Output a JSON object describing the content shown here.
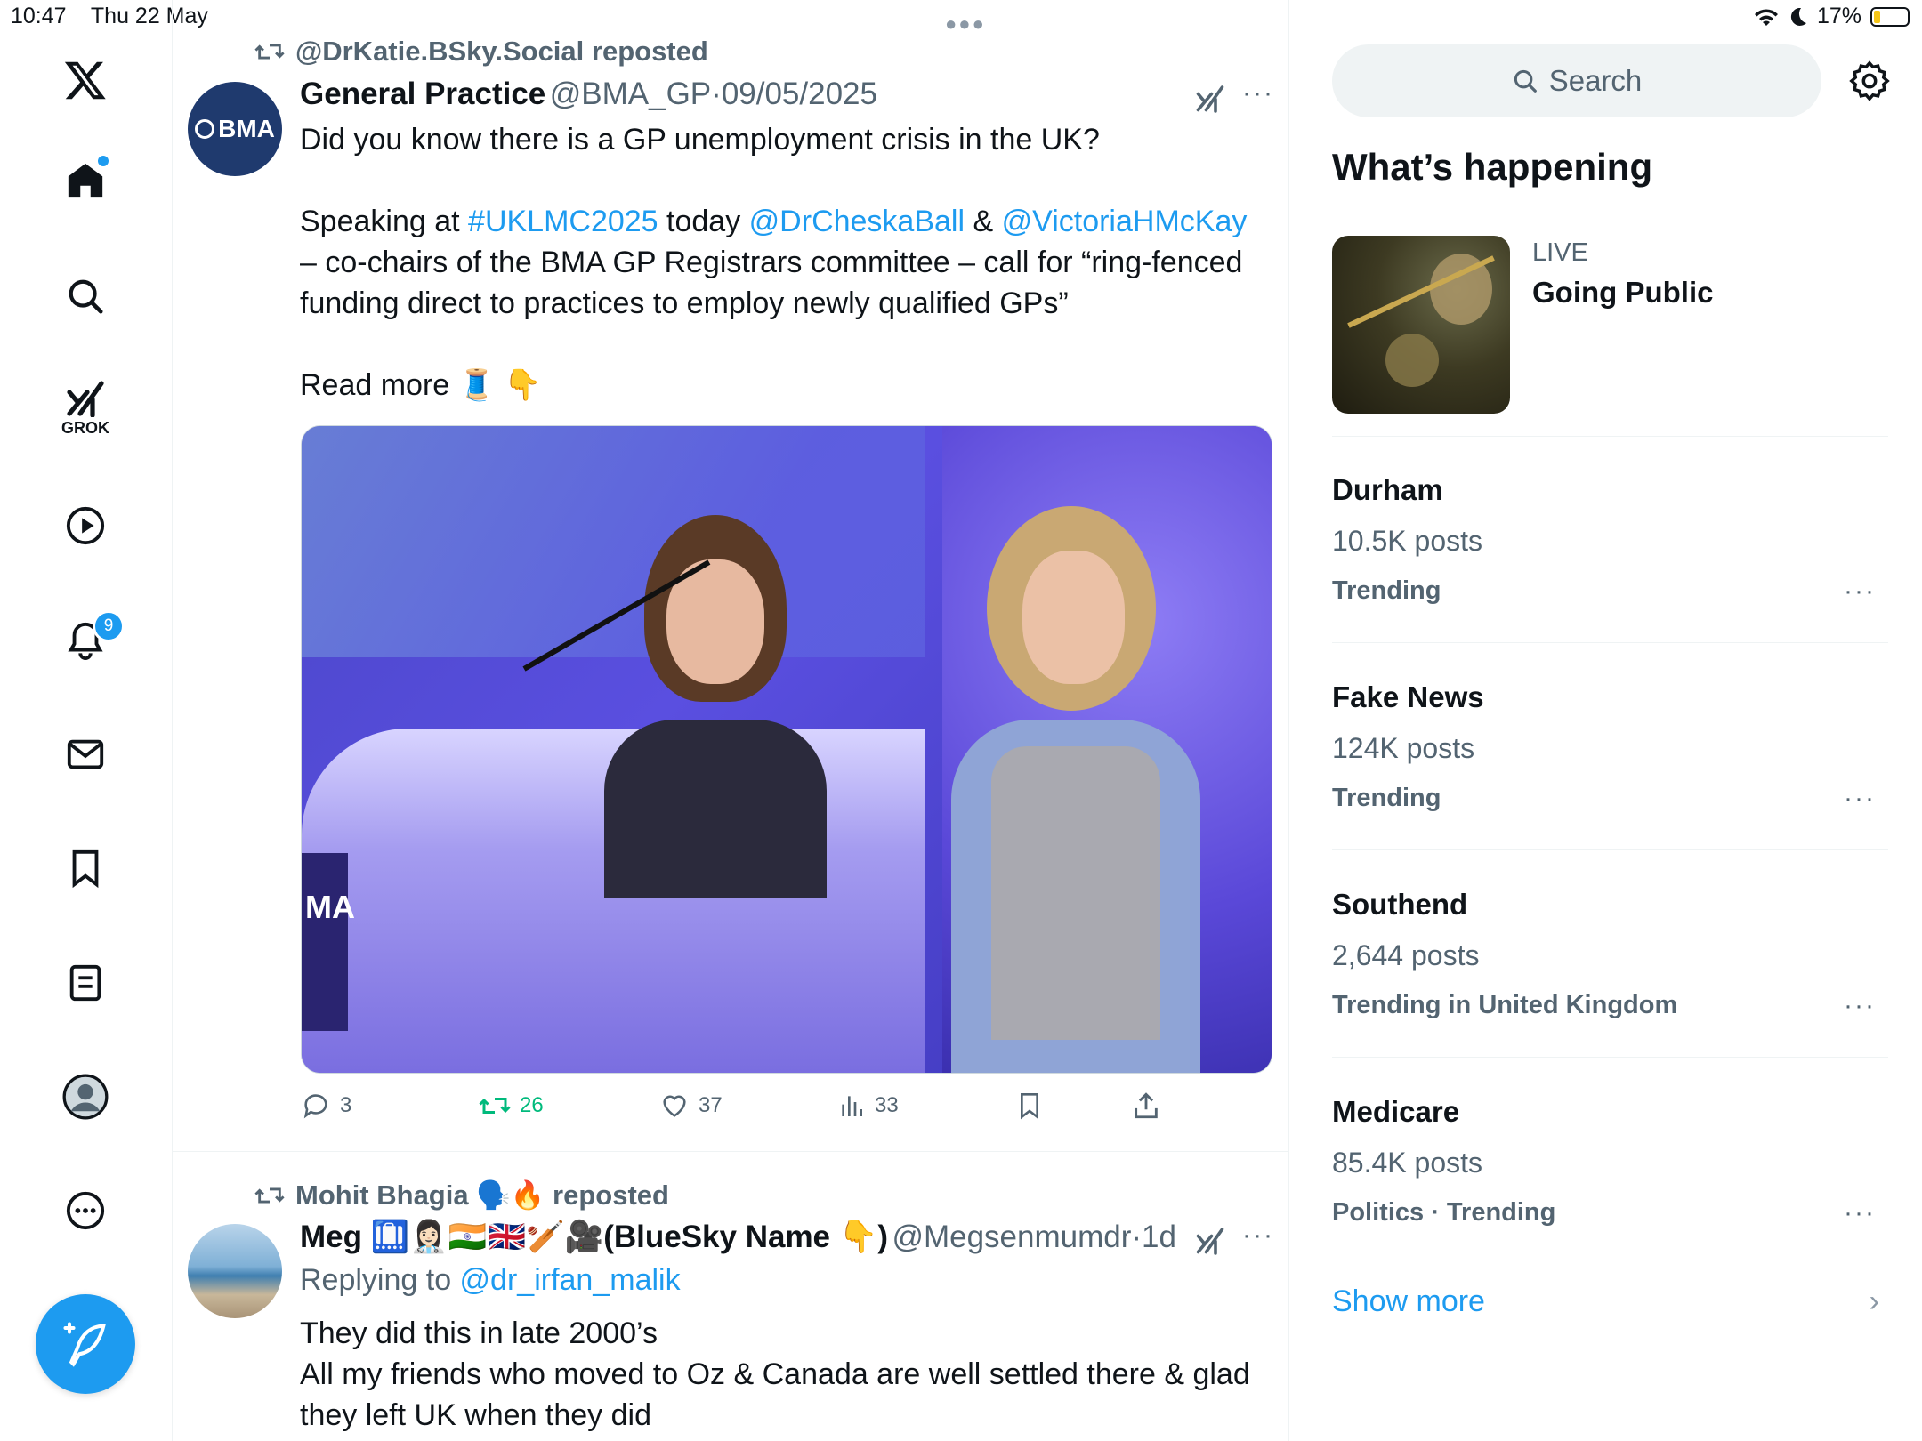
{
  "status_bar": {
    "time": "10:47",
    "date": "Thu 22 May",
    "battery": "17%"
  },
  "nav": {
    "grok_label": "GROK",
    "notifications_badge": "9"
  },
  "tweets": [
    {
      "repost_label": "@DrKatie.BSky.Social reposted",
      "avatar_text": "BMA",
      "name": "General Practice",
      "handle": "@BMA_GP",
      "sep": "·",
      "date": "09/05/2025",
      "line1": "Did you know there is a GP unemployment crisis in the UK?",
      "p2_a": "Speaking at ",
      "p2_tag": "#UKLMC2025",
      "p2_b": " today ",
      "p2_m1": "@DrCheskaBall",
      "p2_c": " & ",
      "p2_m2": "@VictoriaHMcKay",
      "p2_d": " – co-chairs of the BMA GP Registrars committee – call for “ring-fenced funding direct to practices to employ newly qualified GPs”",
      "read_more": "Read more 🧵 👇",
      "image_lanyard": "MA",
      "replies": "3",
      "reposts": "26",
      "likes": "37",
      "views": "33"
    },
    {
      "repost_label": "Mohit Bhagia 🗣️🔥 reposted",
      "name": "Meg 🛄👩🏻‍⚕️🇮🇳🇬🇧🏏🎥(BlueSky Name 👇)",
      "handle": "@Megsenmumdr",
      "sep": "·",
      "date": "1d",
      "replying_prefix": "Replying to ",
      "replying_to": "@dr_irfan_malik",
      "line1": "They did this in late 2000’s",
      "line2": "All my friends who moved to Oz & Canada are well settled there & glad they left UK when they did"
    }
  ],
  "sidebar": {
    "search_placeholder": "Search",
    "heading": "What’s happening",
    "live": {
      "tag": "LIVE",
      "title": "Going Public"
    },
    "trends": [
      {
        "title": "Durham",
        "posts": "10.5K posts",
        "context": "Trending"
      },
      {
        "title": "Fake News",
        "posts": "124K posts",
        "context": "Trending"
      },
      {
        "title": "Southend",
        "posts": "2,644 posts",
        "context": "Trending in United Kingdom"
      },
      {
        "title": "Medicare",
        "posts": "85.4K posts",
        "context": "Politics · Trending"
      }
    ],
    "show_more": "Show more"
  },
  "colors": {
    "accent": "#1d9bf0",
    "repost_green": "#00ba7c",
    "muted": "#536471",
    "text": "#0f1419",
    "bma_blue": "#1f3a6e"
  }
}
